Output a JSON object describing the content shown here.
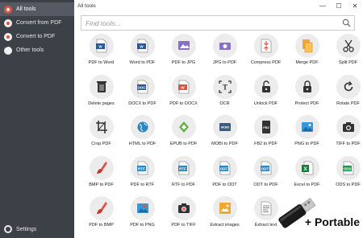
{
  "sidebar": {
    "items": [
      {
        "label": "All tools",
        "icon": "all-tools-icon"
      },
      {
        "label": "Convert from PDF",
        "icon": "convert-from-pdf-icon"
      },
      {
        "label": "Convert to PDF",
        "icon": "convert-to-pdf-icon"
      },
      {
        "label": "Other tools",
        "icon": "other-tools-icon"
      }
    ],
    "settings_label": "Settings"
  },
  "window": {
    "title": "All tools",
    "minimize": "—",
    "maximize": "☐",
    "close": "✕"
  },
  "search": {
    "placeholder": "Find tools..."
  },
  "tools": [
    {
      "label": "PDF to Word",
      "icon": "pdf-to-word-icon"
    },
    {
      "label": "Word to PDF",
      "icon": "word-to-pdf-icon"
    },
    {
      "label": "PDF to JPG",
      "icon": "pdf-to-jpg-icon"
    },
    {
      "label": "JPG to PDF",
      "icon": "jpg-to-pdf-icon"
    },
    {
      "label": "Compress PDF",
      "icon": "compress-pdf-icon"
    },
    {
      "label": "Merge PDF",
      "icon": "merge-pdf-icon"
    },
    {
      "label": "Split PDF",
      "icon": "scissors-icon"
    },
    {
      "label": "Delete pages",
      "icon": "trash-icon"
    },
    {
      "label": "DOCX to PDF",
      "icon": "docx-to-pdf-icon"
    },
    {
      "label": "PDF to DOCX",
      "icon": "pdf-to-docx-icon"
    },
    {
      "label": "OCR",
      "icon": "ocr-icon"
    },
    {
      "label": "Unlock PDF",
      "icon": "unlock-icon"
    },
    {
      "label": "Protect PDF",
      "icon": "lock-icon"
    },
    {
      "label": "Rotate PDF",
      "icon": "rotate-icon"
    },
    {
      "label": "Crop PDF",
      "icon": "crop-icon"
    },
    {
      "label": "HTML to PDF",
      "icon": "globe-icon"
    },
    {
      "label": "EPUB to PDF",
      "icon": "epub-icon"
    },
    {
      "label": "MOBI to PDF",
      "icon": "mobi-icon"
    },
    {
      "label": "FB2 to PDF",
      "icon": "fb2-icon"
    },
    {
      "label": "PNG to PDF",
      "icon": "png-image-icon"
    },
    {
      "label": "TIFF to PDF",
      "icon": "camera-icon"
    },
    {
      "label": "BMP to PDF",
      "icon": "paintbrush-icon"
    },
    {
      "label": "PDF to RTF",
      "icon": "pdf-to-rtf-icon"
    },
    {
      "label": "RTF to PDF",
      "icon": "rtf-to-pdf-icon"
    },
    {
      "label": "PDF to ODT",
      "icon": "pdf-to-odt-icon"
    },
    {
      "label": "ODT to PDF",
      "icon": "odt-to-pdf-icon"
    },
    {
      "label": "Excel to PDF",
      "icon": "excel-icon"
    },
    {
      "label": "ODS to PDF",
      "icon": "ods-icon"
    },
    {
      "label": "PDF to BMP",
      "icon": "pdf-to-bmp-icon"
    },
    {
      "label": "PDF to PNG",
      "icon": "pdf-to-png-icon"
    },
    {
      "label": "PDF to TIFF",
      "icon": "pdf-to-tiff-icon"
    },
    {
      "label": "Extract images",
      "icon": "extract-images-icon"
    },
    {
      "label": "Extract text",
      "icon": "extract-text-icon"
    }
  ],
  "overlay": {
    "portable_label": "+ Portable"
  },
  "colors": {
    "sidebar_bg": "#3c4047",
    "sidebar_active": "#555a62",
    "accent_red": "#e0533f",
    "word_blue": "#2b5797",
    "excel_green": "#1e7a3c",
    "circle_bg": "#ececec"
  }
}
